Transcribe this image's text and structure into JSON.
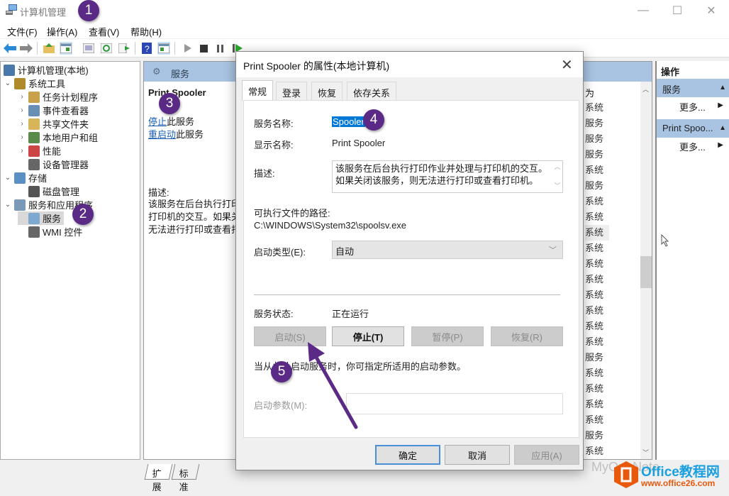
{
  "window": {
    "title": "计算机管理",
    "controls": {
      "minimize": "—",
      "maximize": "☐",
      "close": "✕"
    }
  },
  "menu": [
    "文件(F)",
    "操作(A)",
    "查看(V)",
    "帮助(H)"
  ],
  "toolbar": {
    "icons": [
      "back-arrow-icon",
      "forward-arrow-icon",
      "up-folder-icon",
      "show-hide-console-tree-icon",
      "properties-icon",
      "refresh-icon",
      "export-list-icon",
      "help-icon",
      "show-hide-action-pane-icon",
      "start-service-icon",
      "stop-service-icon",
      "pause-service-icon",
      "restart-service-icon"
    ]
  },
  "tree": {
    "root": "计算机管理(本地)",
    "items": [
      {
        "label": "系统工具",
        "level": 1,
        "expander": "expanded"
      },
      {
        "label": "任务计划程序",
        "level": 2,
        "expander": "collapsed"
      },
      {
        "label": "事件查看器",
        "level": 2,
        "expander": "collapsed"
      },
      {
        "label": "共享文件夹",
        "level": 2,
        "expander": "collapsed"
      },
      {
        "label": "本地用户和组",
        "level": 2,
        "expander": "collapsed"
      },
      {
        "label": "性能",
        "level": 2,
        "expander": "collapsed"
      },
      {
        "label": "设备管理器",
        "level": 2,
        "expander": "none"
      },
      {
        "label": "存储",
        "level": 1,
        "expander": "expanded"
      },
      {
        "label": "磁盘管理",
        "level": 2,
        "expander": "none"
      },
      {
        "label": "服务和应用程序",
        "level": 1,
        "expander": "expanded"
      },
      {
        "label": "服务",
        "level": 2,
        "expander": "none",
        "selected": true
      },
      {
        "label": "WMI 控件",
        "level": 2,
        "expander": "none"
      }
    ]
  },
  "middle": {
    "header": "服务",
    "service_name": "Print Spooler",
    "stop_link": "停止",
    "stop_suffix": "此服务",
    "restart_link": "重启动",
    "restart_suffix": "此服务",
    "desc_label": "描述:",
    "desc_lines": [
      "该服务在后台执行打印作业并处理与",
      "打印机的交互。如果关闭该服务，则",
      "无法进行打印或查看打印机。"
    ],
    "column_header": "为",
    "column_values": [
      "系统",
      "服务",
      "服务",
      "服务",
      "系统",
      "服务",
      "系统",
      "系统",
      "系统",
      "系统",
      "系统",
      "系统",
      "系统",
      "系统",
      "系统",
      "系统",
      "服务",
      "系统",
      "系统",
      "系统",
      "系统",
      "服务",
      "系统"
    ],
    "highlighted_row": 8,
    "bottom_tabs": [
      "扩展",
      "标准"
    ]
  },
  "actions": {
    "title": "操作",
    "groups": [
      {
        "header": "服务",
        "more": "更多..."
      },
      {
        "header": "Print Spoo...",
        "more": "更多..."
      }
    ]
  },
  "dialog": {
    "title": "Print Spooler 的属性(本地计算机)",
    "tabs": [
      "常规",
      "登录",
      "恢复",
      "依存关系"
    ],
    "active_tab": 0,
    "service_name_label": "服务名称:",
    "service_name_value": "Spooler",
    "display_name_label": "显示名称:",
    "display_name_value": "Print Spooler",
    "description_label": "描述:",
    "description_value": "该服务在后台执行打印作业并处理与打印机的交互。如果关闭该服务，则无法进行打印或查看打印机。",
    "path_label": "可执行文件的路径:",
    "path_value": "C:\\WINDOWS\\System32\\spoolsv.exe",
    "startup_type_label": "启动类型(E):",
    "startup_type_value": "自动",
    "status_label": "服务状态:",
    "status_value": "正在运行",
    "buttons": {
      "start": "启动(S)",
      "stop": "停止(T)",
      "pause": "暂停(P)",
      "resume": "恢复(R)"
    },
    "hint": "当从此处启动服务时，你可指定所适用的启动参数。",
    "params_label": "启动参数(M):",
    "params_value": "",
    "ok": "确定",
    "cancel": "取消",
    "apply": "应用(A)"
  },
  "annotations": [
    "1",
    "2",
    "3",
    "4",
    "5"
  ],
  "watermark": {
    "brand": "Office教程网",
    "url": "www.office26.com",
    "faded": "MyOneNote"
  },
  "colors": {
    "accent_purple": "#5b2a86",
    "header_blue": "#a9c4e2",
    "selection_blue": "#0078d7",
    "brand_orange": "#e8590c"
  }
}
